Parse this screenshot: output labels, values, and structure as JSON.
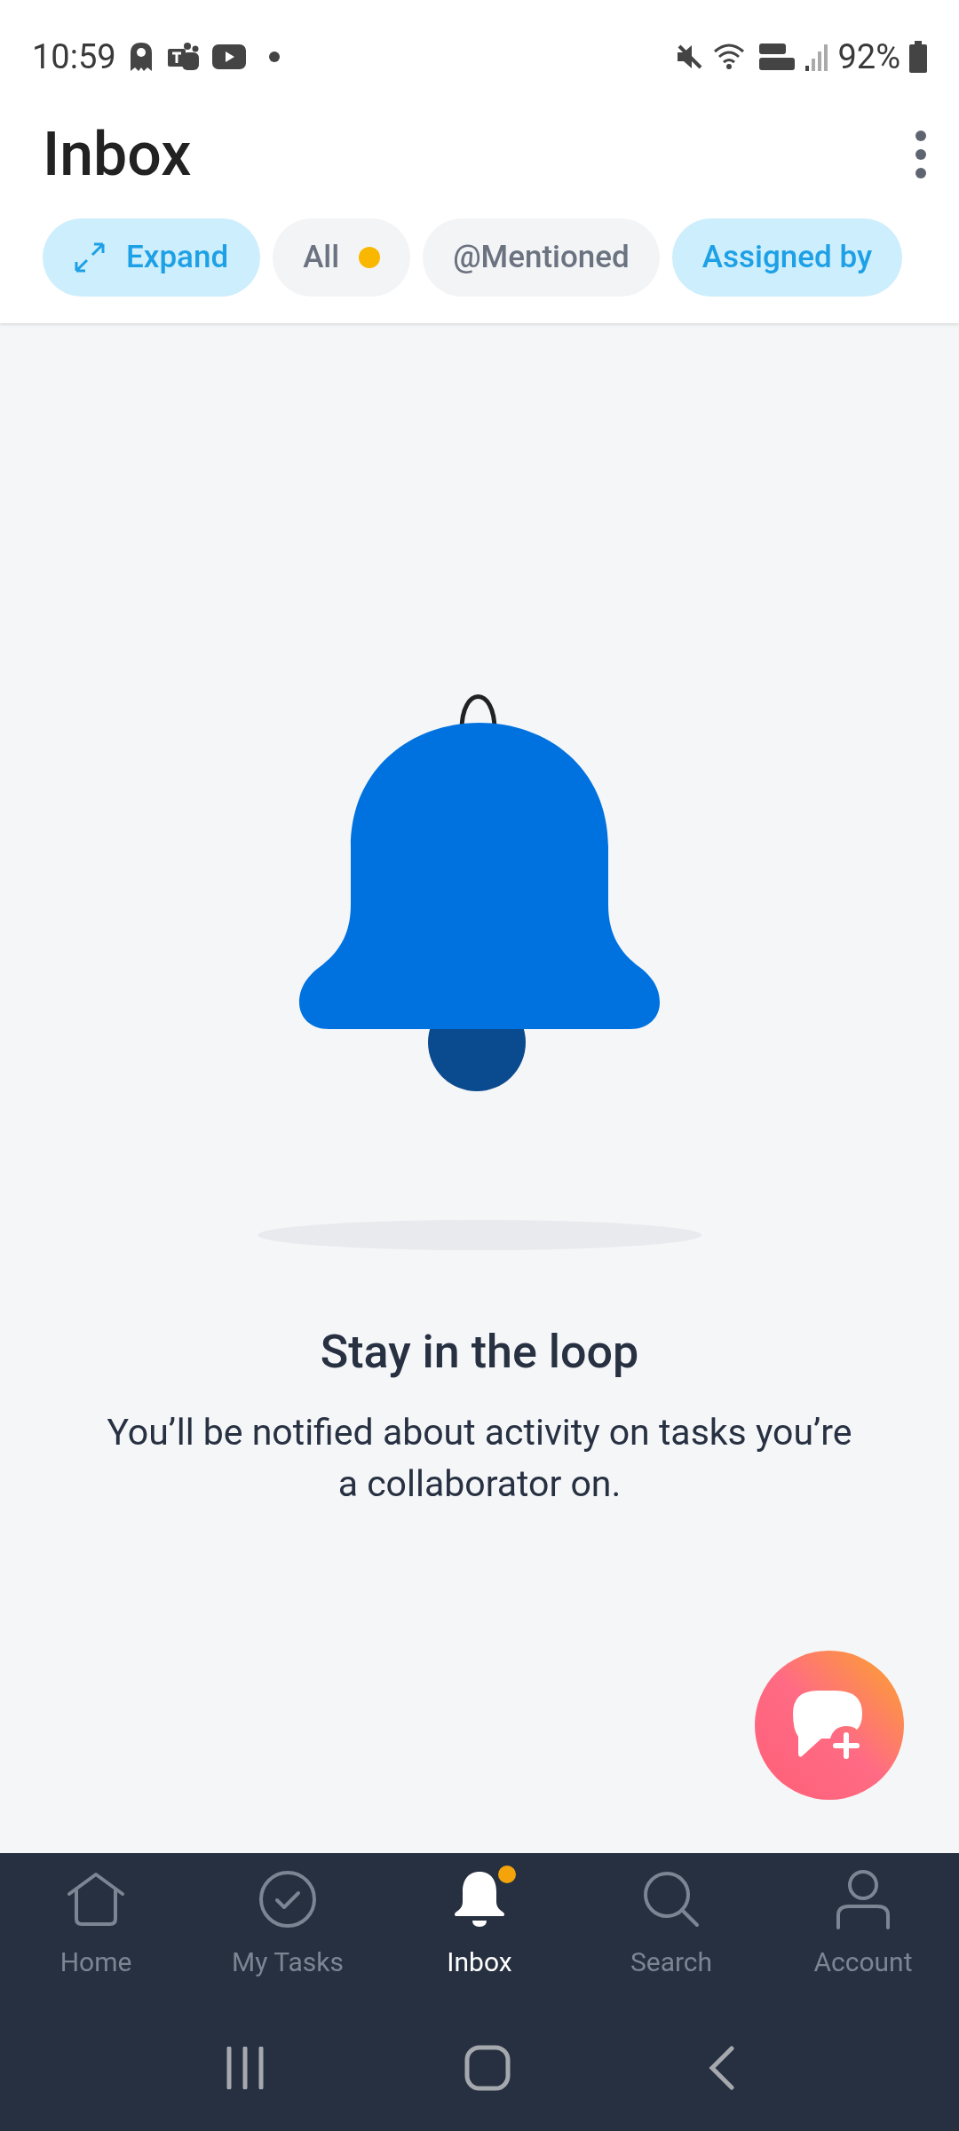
{
  "status_bar": {
    "time": "10:59",
    "battery": "92%"
  },
  "header": {
    "title": "Inbox"
  },
  "expand_button": {
    "label": "Expand"
  },
  "filters": [
    {
      "label": "All",
      "selected": false,
      "color": "#f9b700"
    },
    {
      "label": "@Mentioned",
      "selected": false
    },
    {
      "label": "Assigned by",
      "selected": true
    }
  ],
  "empty_state": {
    "title": "Stay in the loop",
    "message": "You’ll be notified about activity on tasks you’re a collaborator on."
  },
  "bottom_nav": [
    {
      "kind": "home",
      "label": "Home",
      "selected": false,
      "badge": false
    },
    {
      "kind": "tasks",
      "label": "My Tasks",
      "selected": false,
      "badge": false
    },
    {
      "kind": "inbox",
      "label": "Inbox",
      "selected": true,
      "badge": true
    },
    {
      "kind": "search",
      "label": "Search",
      "selected": false,
      "badge": false
    },
    {
      "kind": "account",
      "label": "Account",
      "selected": false,
      "badge": false
    }
  ]
}
